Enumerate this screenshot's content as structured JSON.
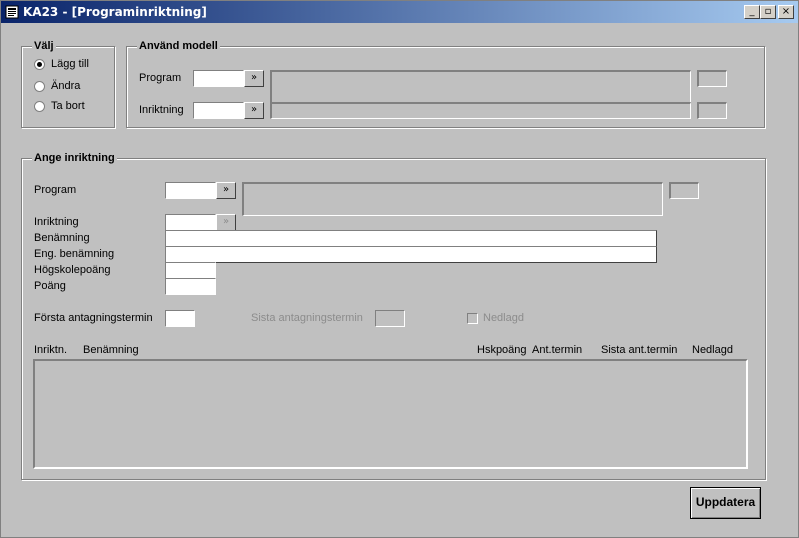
{
  "window": {
    "title": "KA23 - [Programinriktning]",
    "controls": {
      "minimize": "_",
      "restore": "▫",
      "close": "×"
    }
  },
  "valj": {
    "label": "Välj",
    "options": [
      {
        "label": "Lägg till",
        "selected": true
      },
      {
        "label": "Ändra",
        "selected": false
      },
      {
        "label": "Ta bort",
        "selected": false
      }
    ]
  },
  "modell": {
    "label": "Använd modell",
    "program_label": "Program",
    "inriktning_label": "Inriktning",
    "lookup_glyph": "»"
  },
  "ange": {
    "label": "Ange inriktning",
    "program_label": "Program",
    "inriktning_label": "Inriktning",
    "benamning_label": "Benämning",
    "eng_benamning_label": "Eng. benämning",
    "hogskolepoang_label": "Högskolepoäng",
    "poang_label": "Poäng",
    "forsta_label": "Första antagningstermin",
    "sista_label": "Sista antagningstermin",
    "nedlagd_label": "Nedlagd",
    "lookup_glyph": "»"
  },
  "table": {
    "columns": [
      "Inriktn.",
      "Benämning",
      "Hskpoäng",
      "Ant.termin",
      "Sista ant.termin",
      "Nedlagd"
    ],
    "rows": []
  },
  "actions": {
    "update_label": "Uppdatera"
  }
}
